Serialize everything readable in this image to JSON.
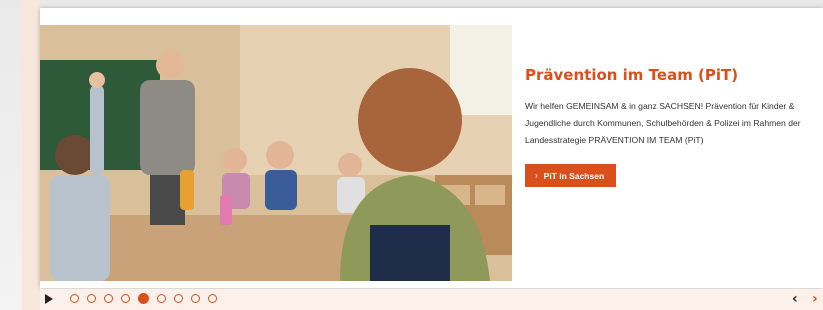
{
  "slide": {
    "title": "Prävention im Team (PiT)",
    "description": "Wir helfen GEMEINSAM & in ganz SACHSEN! Prävention für Kinder & Jugendliche durch Kommunen, Schulbehörden & Polizei im Rahmen der Landesstrategie PRÄVENTION IM TEAM (PiT)",
    "button_label": "PiT in Sachsen",
    "button_icon": "chevron-right-icon",
    "image_alt": "classroom photo"
  },
  "slider_controls": {
    "play_icon": "play-icon",
    "total_slides": 9,
    "active_slide": 5,
    "prev_label": "‹",
    "next_label": "›"
  },
  "colors": {
    "accent": "#d9501c",
    "text": "#333333",
    "control_bar": "#fbf1ea"
  }
}
